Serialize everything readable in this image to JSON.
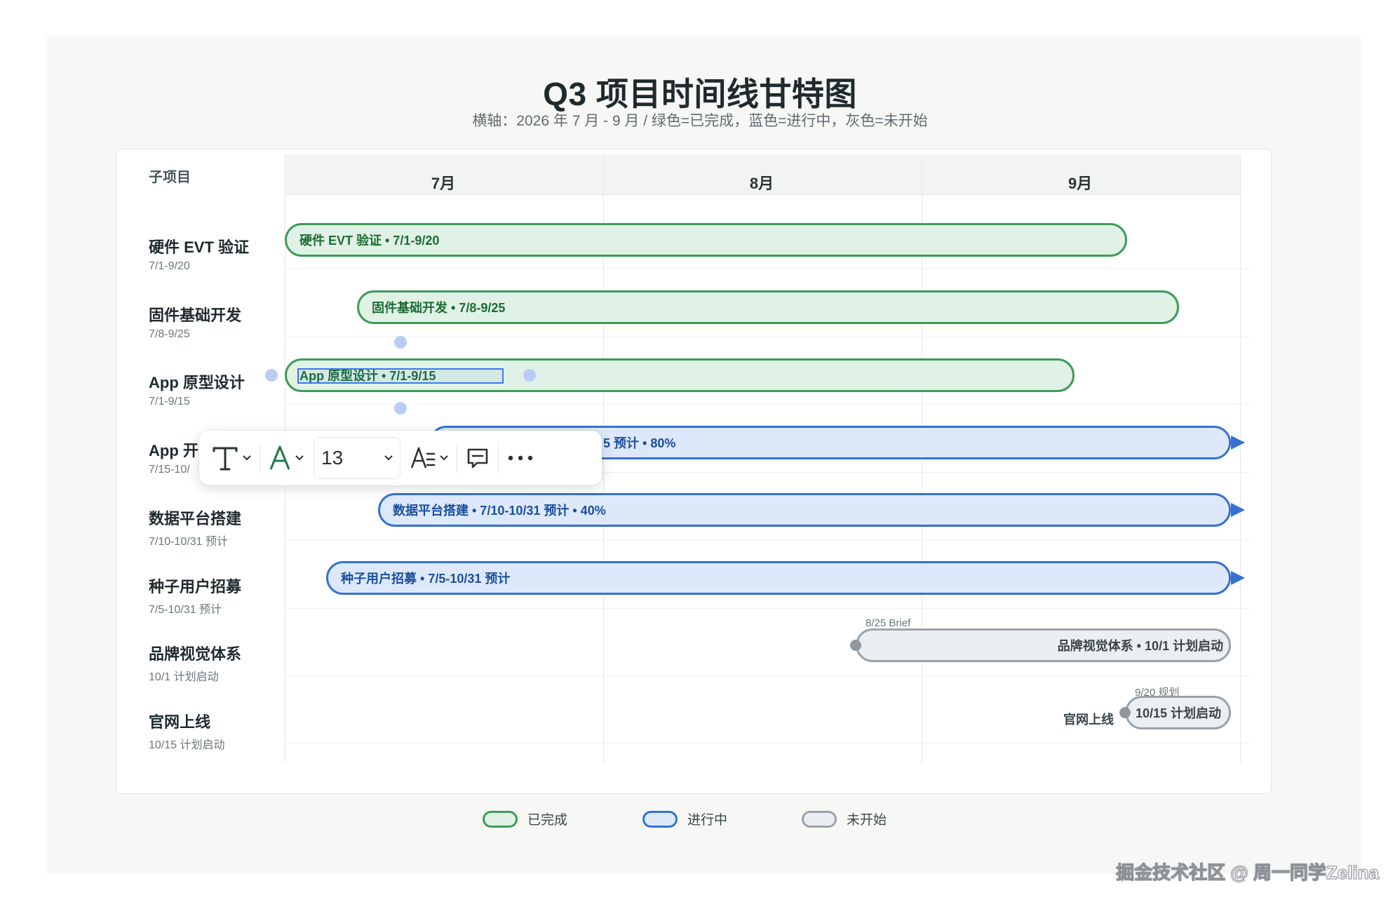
{
  "header": {
    "title": "Q3 项目时间线甘特图",
    "subtitle": "横轴：2026 年 7 月 - 9 月 / 绿色=已完成，蓝色=进行中，灰色=未开始"
  },
  "grid": {
    "column_header": "子项目",
    "months": [
      "7月",
      "8月",
      "9月"
    ]
  },
  "rows": [
    {
      "name": "硬件 EVT 验证",
      "sub": "7/1-9/20",
      "bar_label": "硬件 EVT 验证 • 7/1-9/20",
      "status": "done"
    },
    {
      "name": "固件基础开发",
      "sub": "7/8-9/25",
      "bar_label": "固件基础开发 • 7/8-9/25",
      "status": "done"
    },
    {
      "name": "App 原型设计",
      "sub": "7/1-9/15",
      "bar_label": "App 原型设计 • 7/1-9/15",
      "status": "done"
    },
    {
      "name": "App 开",
      "sub": "7/15-10/",
      "bar_label": "5 预计 • 80%",
      "status": "in-progress"
    },
    {
      "name": "数据平台搭建",
      "sub": "7/10-10/31 预计",
      "bar_label": "数据平台搭建 • 7/10-10/31 预计 • 40%",
      "status": "in-progress"
    },
    {
      "name": "种子用户招募",
      "sub": "7/5-10/31 预计",
      "bar_label": "种子用户招募 • 7/5-10/31 预计",
      "status": "in-progress"
    },
    {
      "name": "品牌视觉体系",
      "sub": "10/1 计划启动",
      "bar_label": "品牌视觉体系 • 10/1 计划启动",
      "status": "not-started",
      "milestone": "8/25 Brief"
    },
    {
      "name": "官网上线",
      "sub": "10/15 计划启动",
      "bar_label": "10/15 计划启动",
      "outside_label": "官网上线",
      "status": "not-started",
      "milestone": "9/20 规划"
    }
  ],
  "toolbar": {
    "font_size": "13",
    "items": [
      "text-style",
      "font-color",
      "font-size",
      "text-format",
      "comment",
      "more"
    ]
  },
  "legend": {
    "done": "已完成",
    "in_progress": "进行中",
    "not_started": "未开始"
  },
  "colors": {
    "done_fill": "#e0f2e5",
    "done_border": "#3f9a58",
    "progress_fill": "#dde9fb",
    "progress_border": "#3572cf",
    "todo_fill": "#eceff2",
    "todo_border": "#9aa3aa",
    "selection": "#3b78e7"
  },
  "watermark": "掘金技术社区 @ 周一同学Zelina"
}
